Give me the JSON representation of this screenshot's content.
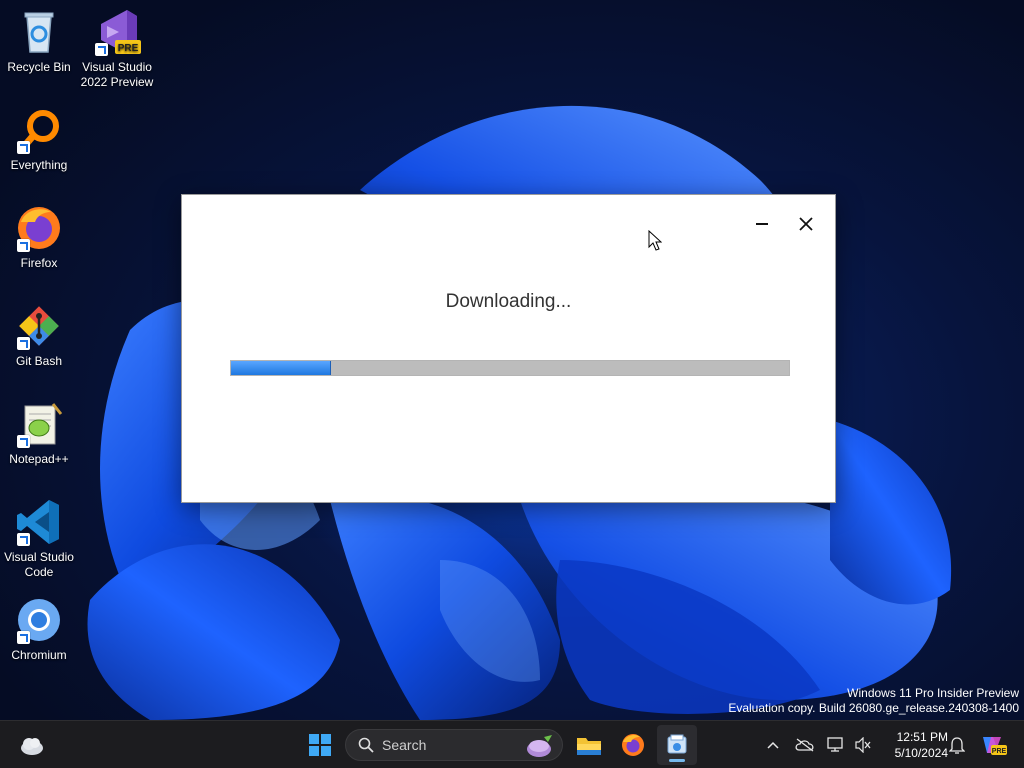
{
  "desktop": {
    "icons": [
      {
        "label": "Recycle Bin"
      },
      {
        "label": "Visual Studio 2022 Preview"
      },
      {
        "label": "Everything"
      },
      {
        "label": "Firefox"
      },
      {
        "label": "Git Bash"
      },
      {
        "label": "Notepad++"
      },
      {
        "label": "Visual Studio Code"
      },
      {
        "label": "Chromium"
      }
    ],
    "vs_badge": "PRE"
  },
  "dialog": {
    "status_text": "Downloading...",
    "progress_percent": 18,
    "minimize_icon": "minimize-icon",
    "close_icon": "close-icon"
  },
  "watermark": {
    "line1": "Windows 11 Pro Insider Preview",
    "line2": "Evaluation copy. Build 26080.ge_release.240308-1400"
  },
  "taskbar": {
    "search_placeholder": "Search",
    "apps": [
      "start",
      "search",
      "file-explorer",
      "firefox",
      "setup-app"
    ],
    "active_app": "setup-app",
    "clock_time": "12:51 PM",
    "clock_date": "5/10/2024",
    "copilot_badge": "PRE"
  },
  "colors": {
    "accent": "#1f78e0",
    "taskbar": "#1c1c1f",
    "progress_track": "#bcbcbc"
  }
}
